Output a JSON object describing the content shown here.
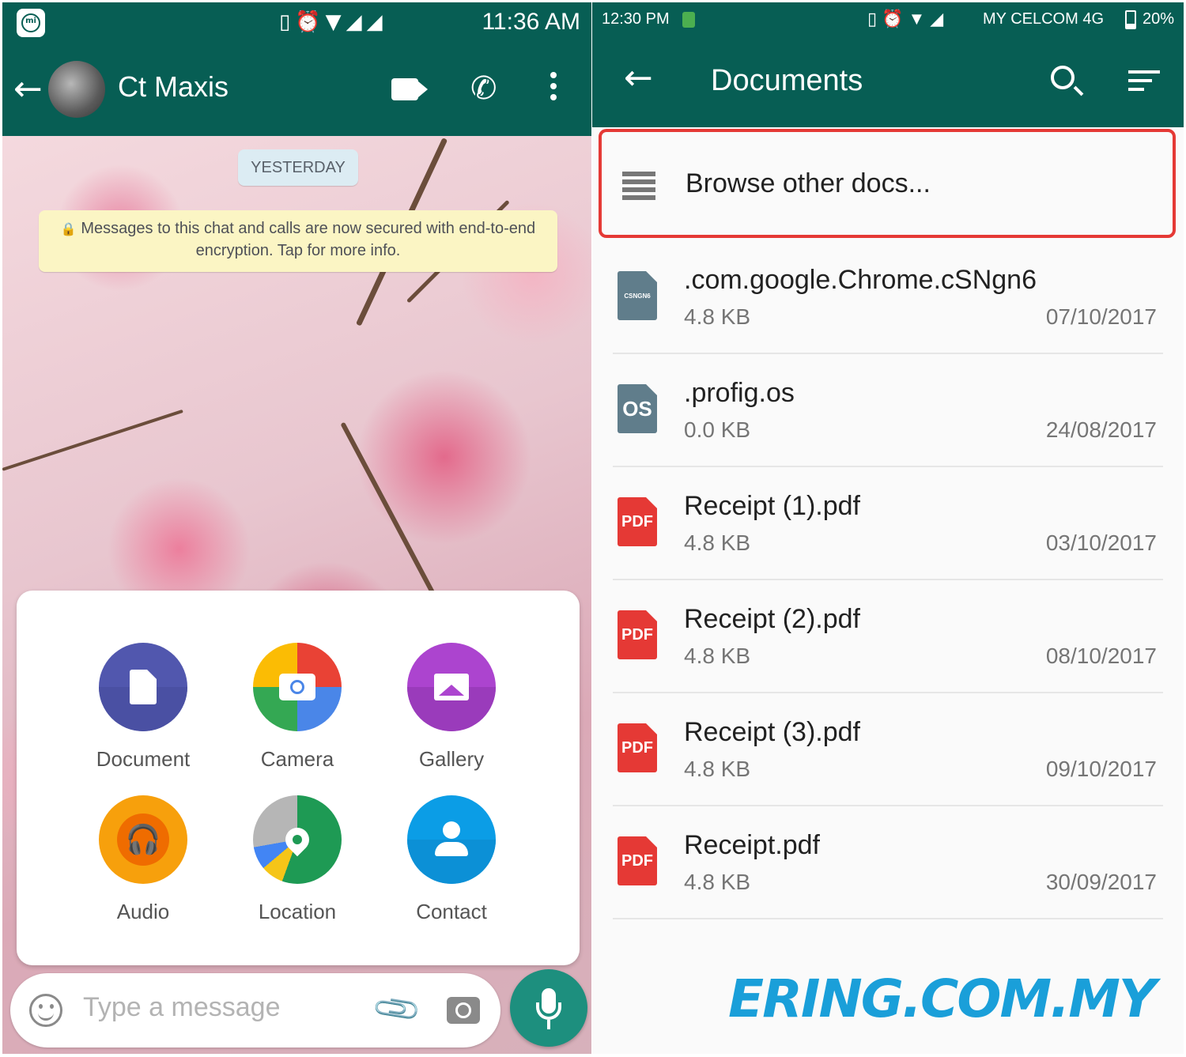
{
  "left": {
    "status": {
      "icons": "▯⏰▼◢◢",
      "time": "11:36 AM"
    },
    "header": {
      "contact_name": "Ct Maxis"
    },
    "date_chip": "YESTERDAY",
    "encryption_notice": "Messages to this chat and calls are now secured with end-to-end encryption. Tap for more info.",
    "attach_menu": [
      {
        "label": "Document"
      },
      {
        "label": "Camera"
      },
      {
        "label": "Gallery"
      },
      {
        "label": "Audio"
      },
      {
        "label": "Location"
      },
      {
        "label": "Contact"
      }
    ],
    "input": {
      "placeholder": "Type a message"
    }
  },
  "right": {
    "status": {
      "time": "12:30 PM",
      "icons": "▯⏰▼◢",
      "carrier": "MY CELCOM 4G",
      "battery": "20%"
    },
    "header": {
      "title": "Documents"
    },
    "browse_label": "Browse other docs...",
    "files": [
      {
        "name": ".com.google.Chrome.cSNgn6",
        "size": "4.8 KB",
        "date": "07/10/2017",
        "icon_text": "CSNGN6"
      },
      {
        "name": ".profig.os",
        "size": "0.0 KB",
        "date": "24/08/2017",
        "icon_text": "OS"
      },
      {
        "name": "Receipt (1).pdf",
        "size": "4.8 KB",
        "date": "03/10/2017",
        "icon_text": "PDF"
      },
      {
        "name": "Receipt (2).pdf",
        "size": "4.8 KB",
        "date": "08/10/2017",
        "icon_text": "PDF"
      },
      {
        "name": "Receipt (3).pdf",
        "size": "4.8 KB",
        "date": "09/10/2017",
        "icon_text": "PDF"
      },
      {
        "name": "Receipt.pdf",
        "size": "4.8 KB",
        "date": "30/09/2017",
        "icon_text": "PDF"
      }
    ],
    "watermark": "ERING.COM.MY"
  },
  "colors": {
    "whatsapp_teal": "#075e54",
    "mic_green": "#1d8f7e",
    "highlight_red": "#e53935",
    "pdf_red": "#e53935",
    "watermark_blue": "#1a9fd9"
  }
}
